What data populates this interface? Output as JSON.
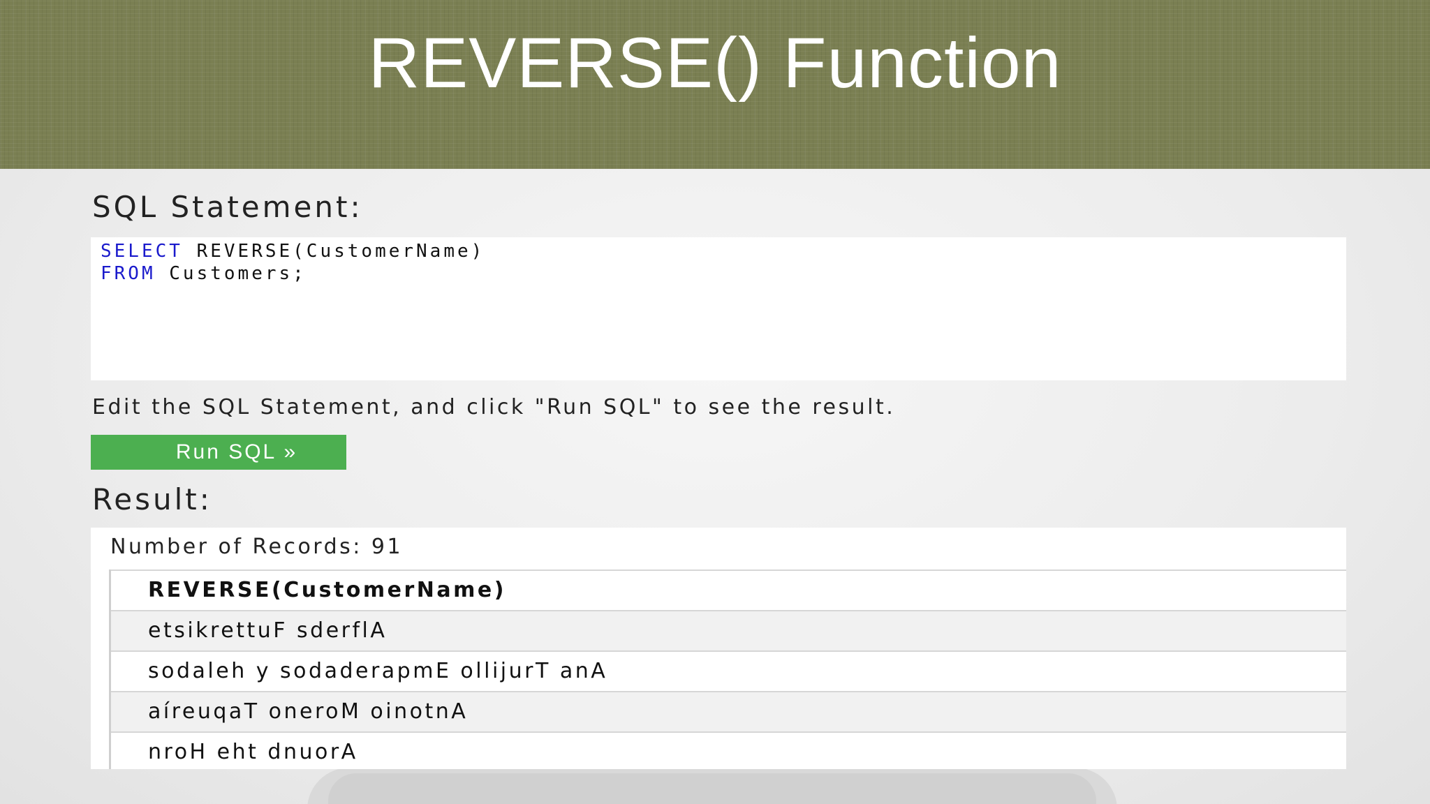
{
  "slide": {
    "title": "REVERSE() Function"
  },
  "editor": {
    "heading": "SQL Statement:",
    "line1_keyword": "SELECT",
    "line1_rest": " REVERSE(CustomerName)",
    "line2_keyword": "FROM",
    "line2_rest": " Customers;"
  },
  "instructions": "Edit the SQL Statement, and click \"Run SQL\" to see the result.",
  "run_button": {
    "label": "Run SQL »",
    "color": "#4caf50"
  },
  "result": {
    "heading": "Result:",
    "record_count_text": "Number of Records: 91",
    "columns": [
      "REVERSE(CustomerName)"
    ],
    "rows": [
      "etsikrettuF sderflA",
      "sodaleh y sodaderapmE ollijurT anA",
      "aíreuqaT oneroM oinotnA",
      "nroH eht dnuorA"
    ]
  },
  "colors": {
    "banner": "#7a7f52",
    "sql_keyword": "#1a1acc"
  }
}
